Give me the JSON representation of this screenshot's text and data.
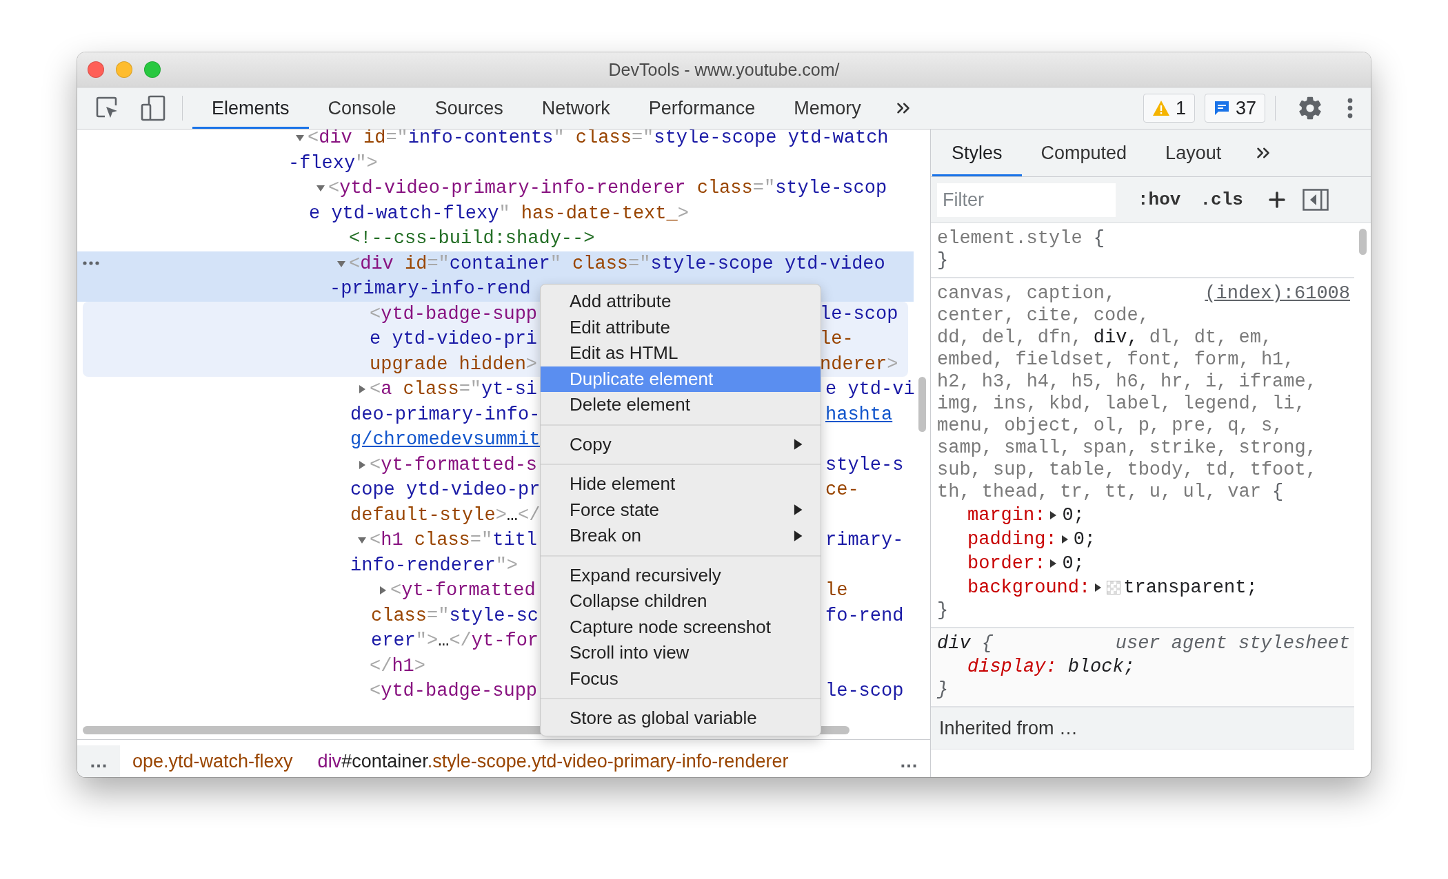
{
  "window": {
    "title": "DevTools - www.youtube.com/"
  },
  "toolbar": {
    "tabs": [
      {
        "label": "Elements",
        "selected": true
      },
      {
        "label": "Console",
        "selected": false
      },
      {
        "label": "Sources",
        "selected": false
      },
      {
        "label": "Network",
        "selected": false
      },
      {
        "label": "Performance",
        "selected": false
      },
      {
        "label": "Memory",
        "selected": false
      }
    ],
    "warnings": "1",
    "messages": "37"
  },
  "elements": {
    "tree": [
      {
        "kind": "element",
        "expanded": true,
        "selected": false,
        "hovered": false,
        "lines": [
          {
            "left": [
              {
                "kind": "bracket",
                "text": "<"
              },
              {
                "kind": "tag",
                "text": "div"
              },
              {
                "kind": "attr",
                "text": " id"
              },
              {
                "kind": "bracket",
                "text": "=\""
              },
              {
                "kind": "value",
                "text": "info-contents"
              },
              {
                "kind": "bracket",
                "text": "\""
              },
              {
                "kind": "attr",
                "text": " class"
              },
              {
                "kind": "bracket",
                "text": "=\""
              },
              {
                "kind": "value",
                "text": "style-scope ytd-watch"
              }
            ]
          },
          {
            "left": [
              {
                "kind": "value",
                "text": "-flexy"
              },
              {
                "kind": "bracket",
                "text": "\">"
              }
            ]
          }
        ],
        "children": [
          {
            "kind": "element",
            "expanded": true,
            "selected": false,
            "hovered": false,
            "lines": [
              {
                "left": [
                  {
                    "kind": "bracket",
                    "text": "<"
                  },
                  {
                    "kind": "tag",
                    "text": "ytd-video-primary-info-renderer"
                  },
                  {
                    "kind": "attr",
                    "text": " class"
                  },
                  {
                    "kind": "bracket",
                    "text": "=\""
                  },
                  {
                    "kind": "value",
                    "text": "style-scop"
                  }
                ]
              },
              {
                "left": [
                  {
                    "kind": "value",
                    "text": "e ytd-watch-flexy"
                  },
                  {
                    "kind": "bracket",
                    "text": "\""
                  },
                  {
                    "kind": "attr",
                    "text": " has-date-text_"
                  },
                  {
                    "kind": "bracket",
                    "text": ">"
                  }
                ]
              }
            ],
            "children": [
              {
                "kind": "leaf",
                "selected": false,
                "hovered": false,
                "lines": [
                  {
                    "left": [
                      {
                        "kind": "comment",
                        "text": "<!--css-build:shady-->"
                      }
                    ]
                  }
                ]
              },
              {
                "kind": "element",
                "expanded": true,
                "selected": true,
                "hovered": false,
                "lines": [
                  {
                    "left": [
                      {
                        "kind": "bracket",
                        "text": "<"
                      },
                      {
                        "kind": "tag",
                        "text": "div"
                      },
                      {
                        "kind": "attr",
                        "text": " id"
                      },
                      {
                        "kind": "bracket",
                        "text": "=\""
                      },
                      {
                        "kind": "value",
                        "text": "container"
                      },
                      {
                        "kind": "bracket",
                        "text": "\""
                      },
                      {
                        "kind": "attr",
                        "text": " class"
                      },
                      {
                        "kind": "bracket",
                        "text": "=\""
                      },
                      {
                        "kind": "value",
                        "text": "style-scope ytd-video"
                      }
                    ]
                  },
                  {
                    "left": [
                      {
                        "kind": "value",
                        "text": "-primary-info-rend"
                      }
                    ]
                  }
                ],
                "children": [
                  {
                    "kind": "leaf",
                    "selected": false,
                    "hovered": true,
                    "lines": [
                      {
                        "left": [
                          {
                            "kind": "bracket",
                            "text": "<"
                          },
                          {
                            "kind": "tag",
                            "text": "ytd-badge-supp"
                          }
                        ],
                        "right": [
                          {
                            "kind": "value",
                            "text": "le-scop"
                          }
                        ]
                      },
                      {
                        "left": [
                          {
                            "kind": "value",
                            "text": "e ytd-video-pri"
                          }
                        ],
                        "right": [
                          {
                            "kind": "attr",
                            "text": "le-"
                          }
                        ]
                      },
                      {
                        "left": [
                          {
                            "kind": "attr",
                            "text": "upgrade hidden"
                          },
                          {
                            "kind": "bracket",
                            "text": ">"
                          }
                        ],
                        "right": [
                          {
                            "kind": "attr",
                            "text": "nderer"
                          },
                          {
                            "kind": "bracket",
                            "text": ">"
                          }
                        ]
                      }
                    ]
                  },
                  {
                    "kind": "element",
                    "expanded": false,
                    "selected": false,
                    "hovered": false,
                    "lines": [
                      {
                        "left": [
                          {
                            "kind": "bracket",
                            "text": "<"
                          },
                          {
                            "kind": "tag",
                            "text": "a"
                          },
                          {
                            "kind": "attr",
                            "text": " class"
                          },
                          {
                            "kind": "bracket",
                            "text": "=\""
                          },
                          {
                            "kind": "value",
                            "text": "yt-si"
                          }
                        ],
                        "right": [
                          {
                            "kind": "value",
                            "text": "e ytd-vi"
                          }
                        ]
                      },
                      {
                        "left": [
                          {
                            "kind": "value",
                            "text": "deo-primary-info-"
                          }
                        ],
                        "right": [
                          {
                            "kind": "link",
                            "text": "hashta"
                          }
                        ]
                      },
                      {
                        "left": [
                          {
                            "kind": "link",
                            "text": "g/chromedevsummit"
                          }
                        ]
                      }
                    ]
                  },
                  {
                    "kind": "element",
                    "expanded": false,
                    "selected": false,
                    "hovered": false,
                    "lines": [
                      {
                        "left": [
                          {
                            "kind": "bracket",
                            "text": "<"
                          },
                          {
                            "kind": "tag",
                            "text": "yt-formatted-s"
                          }
                        ],
                        "right": [
                          {
                            "kind": "value",
                            "text": "style-s"
                          }
                        ]
                      },
                      {
                        "left": [
                          {
                            "kind": "value",
                            "text": "cope ytd-video-pr"
                          }
                        ],
                        "right": [
                          {
                            "kind": "attr",
                            "text": "ce-"
                          }
                        ]
                      },
                      {
                        "left": [
                          {
                            "kind": "attr",
                            "text": "default-style"
                          },
                          {
                            "kind": "bracket",
                            "text": ">"
                          },
                          {
                            "kind": "text",
                            "text": "…"
                          },
                          {
                            "kind": "bracket",
                            "text": "</"
                          }
                        ]
                      }
                    ]
                  },
                  {
                    "kind": "element",
                    "expanded": true,
                    "selected": false,
                    "hovered": false,
                    "lines": [
                      {
                        "left": [
                          {
                            "kind": "bracket",
                            "text": "<"
                          },
                          {
                            "kind": "tag",
                            "text": "h1"
                          },
                          {
                            "kind": "attr",
                            "text": " class"
                          },
                          {
                            "kind": "bracket",
                            "text": "=\""
                          },
                          {
                            "kind": "value",
                            "text": "titl"
                          }
                        ],
                        "right": [
                          {
                            "kind": "value",
                            "text": "rimary-"
                          }
                        ]
                      },
                      {
                        "left": [
                          {
                            "kind": "value",
                            "text": "info-renderer"
                          },
                          {
                            "kind": "bracket",
                            "text": "\">"
                          }
                        ]
                      }
                    ],
                    "children": [
                      {
                        "kind": "element",
                        "expanded": false,
                        "selected": false,
                        "hovered": false,
                        "lines": [
                          {
                            "left": [
                              {
                                "kind": "bracket",
                                "text": "<"
                              },
                              {
                                "kind": "tag",
                                "text": "yt-formatted"
                              }
                            ],
                            "right": [
                              {
                                "kind": "attr",
                                "text": "le"
                              }
                            ]
                          },
                          {
                            "left": [
                              {
                                "kind": "attr",
                                "text": "class"
                              },
                              {
                                "kind": "bracket",
                                "text": "=\""
                              },
                              {
                                "kind": "value",
                                "text": "style-sc"
                              }
                            ],
                            "right": [
                              {
                                "kind": "value",
                                "text": "fo-rend"
                              }
                            ]
                          },
                          {
                            "left": [
                              {
                                "kind": "value",
                                "text": "erer"
                              },
                              {
                                "kind": "bracket",
                                "text": "\">"
                              },
                              {
                                "kind": "text",
                                "text": "…"
                              },
                              {
                                "kind": "bracket",
                                "text": "</"
                              },
                              {
                                "kind": "tag",
                                "text": "yt-for"
                              }
                            ]
                          }
                        ]
                      }
                    ]
                  },
                  {
                    "kind": "leaf",
                    "selected": false,
                    "hovered": false,
                    "lines": [
                      {
                        "left": [
                          {
                            "kind": "bracket",
                            "text": "</"
                          },
                          {
                            "kind": "tag",
                            "text": "h1"
                          },
                          {
                            "kind": "bracket",
                            "text": ">"
                          }
                        ]
                      }
                    ]
                  },
                  {
                    "kind": "leaf",
                    "selected": false,
                    "hovered": false,
                    "lines": [
                      {
                        "left": [
                          {
                            "kind": "bracket",
                            "text": "<"
                          },
                          {
                            "kind": "tag",
                            "text": "ytd-badge-supp"
                          }
                        ],
                        "right": [
                          {
                            "kind": "value",
                            "text": "le-scop"
                          }
                        ]
                      }
                    ]
                  }
                ]
              }
            ]
          }
        ]
      }
    ]
  },
  "menu": {
    "groups": [
      [
        {
          "label": "Add attribute",
          "highlighted": false,
          "submenu": false
        },
        {
          "label": "Edit attribute",
          "highlighted": false,
          "submenu": false
        },
        {
          "label": "Edit as HTML",
          "highlighted": false,
          "submenu": false
        },
        {
          "label": "Duplicate element",
          "highlighted": true,
          "submenu": false
        },
        {
          "label": "Delete element",
          "highlighted": false,
          "submenu": false
        }
      ],
      [
        {
          "label": "Copy",
          "highlighted": false,
          "submenu": true
        }
      ],
      [
        {
          "label": "Hide element",
          "highlighted": false,
          "submenu": false
        },
        {
          "label": "Force state",
          "highlighted": false,
          "submenu": true
        },
        {
          "label": "Break on",
          "highlighted": false,
          "submenu": true
        }
      ],
      [
        {
          "label": "Expand recursively",
          "highlighted": false,
          "submenu": false
        },
        {
          "label": "Collapse children",
          "highlighted": false,
          "submenu": false
        },
        {
          "label": "Capture node screenshot",
          "highlighted": false,
          "submenu": false
        },
        {
          "label": "Scroll into view",
          "highlighted": false,
          "submenu": false
        },
        {
          "label": "Focus",
          "highlighted": false,
          "submenu": false
        }
      ],
      [
        {
          "label": "Store as global variable",
          "highlighted": false,
          "submenu": false
        }
      ]
    ]
  },
  "breadcrumbs": {
    "leading": "…",
    "crumbs": [
      {
        "parts": [
          {
            "kind": "attr",
            "text": "ope.ytd-watch-flexy"
          }
        ]
      },
      {
        "parts": [
          {
            "kind": "tag",
            "text": "div"
          },
          {
            "kind": "text",
            "text": "#container"
          },
          {
            "kind": "attr",
            "text": ".style-scope.ytd-video-primary-info-renderer"
          }
        ]
      }
    ],
    "trailing": "…"
  },
  "styles": {
    "tabs": [
      {
        "label": "Styles",
        "selected": true
      },
      {
        "label": "Computed",
        "selected": false
      },
      {
        "label": "Layout",
        "selected": false
      }
    ],
    "filter": {
      "placeholder": "Filter"
    },
    "hov": ":hov",
    "cls": ".cls",
    "rules": [
      {
        "kind": "rule",
        "user_agent": false,
        "selector_lines": [
          [
            {
              "text": "element.style",
              "matched": false
            }
          ]
        ],
        "open": "{",
        "close": "}"
      },
      {
        "kind": "rule",
        "user_agent": false,
        "source": "(index):61008",
        "selector_lines": [
          [
            {
              "text": "canvas,",
              "matched": false
            },
            {
              "text": "caption,",
              "matched": false
            }
          ],
          [
            {
              "text": "center,",
              "matched": false
            },
            {
              "text": "cite,",
              "matched": false
            },
            {
              "text": "code,",
              "matched": false
            }
          ],
          [
            {
              "text": "dd,",
              "matched": false
            },
            {
              "text": "del,",
              "matched": false
            },
            {
              "text": "dfn,",
              "matched": false
            },
            {
              "text": "div,",
              "matched": true
            },
            {
              "text": "dl,",
              "matched": false
            },
            {
              "text": "dt,",
              "matched": false
            },
            {
              "text": "em,",
              "matched": false
            }
          ],
          [
            {
              "text": "embed,",
              "matched": false
            },
            {
              "text": "fieldset,",
              "matched": false
            },
            {
              "text": "font,",
              "matched": false
            },
            {
              "text": "form,",
              "matched": false
            },
            {
              "text": "h1,",
              "matched": false
            }
          ],
          [
            {
              "text": "h2,",
              "matched": false
            },
            {
              "text": "h3,",
              "matched": false
            },
            {
              "text": "h4,",
              "matched": false
            },
            {
              "text": "h5,",
              "matched": false
            },
            {
              "text": "h6,",
              "matched": false
            },
            {
              "text": "hr,",
              "matched": false
            },
            {
              "text": "i,",
              "matched": false
            },
            {
              "text": "iframe,",
              "matched": false
            }
          ],
          [
            {
              "text": "img,",
              "matched": false
            },
            {
              "text": "ins,",
              "matched": false
            },
            {
              "text": "kbd,",
              "matched": false
            },
            {
              "text": "label,",
              "matched": false
            },
            {
              "text": "legend,",
              "matched": false
            },
            {
              "text": "li,",
              "matched": false
            }
          ],
          [
            {
              "text": "menu,",
              "matched": false
            },
            {
              "text": "object,",
              "matched": false
            },
            {
              "text": "ol,",
              "matched": false
            },
            {
              "text": "p,",
              "matched": false
            },
            {
              "text": "pre,",
              "matched": false
            },
            {
              "text": "q,",
              "matched": false
            },
            {
              "text": "s,",
              "matched": false
            }
          ],
          [
            {
              "text": "samp,",
              "matched": false
            },
            {
              "text": "small,",
              "matched": false
            },
            {
              "text": "span,",
              "matched": false
            },
            {
              "text": "strike,",
              "matched": false
            },
            {
              "text": "strong,",
              "matched": false
            }
          ],
          [
            {
              "text": "sub,",
              "matched": false
            },
            {
              "text": "sup,",
              "matched": false
            },
            {
              "text": "table,",
              "matched": false
            },
            {
              "text": "tbody,",
              "matched": false
            },
            {
              "text": "td,",
              "matched": false
            },
            {
              "text": "tfoot,",
              "matched": false
            }
          ],
          [
            {
              "text": "th,",
              "matched": false
            },
            {
              "text": "thead,",
              "matched": false
            },
            {
              "text": "tr,",
              "matched": false
            },
            {
              "text": "tt,",
              "matched": false
            },
            {
              "text": "u,",
              "matched": false
            },
            {
              "text": "ul,",
              "matched": false
            },
            {
              "text": "var",
              "matched": false
            }
          ]
        ],
        "open": "{",
        "properties": [
          {
            "name": "margin:",
            "value": "0;",
            "expandable": true,
            "swatch": false
          },
          {
            "name": "padding:",
            "value": "0;",
            "expandable": true,
            "swatch": false
          },
          {
            "name": "border:",
            "value": "0;",
            "expandable": true,
            "swatch": false
          },
          {
            "name": "background:",
            "value": "transparent;",
            "expandable": true,
            "swatch": true
          }
        ],
        "close": "}"
      },
      {
        "kind": "rule",
        "user_agent": true,
        "source": "user agent stylesheet",
        "selector_lines": [
          [
            {
              "text": "div",
              "matched": true
            }
          ]
        ],
        "open": "{",
        "properties": [
          {
            "name": "display:",
            "value": "block;",
            "expandable": false,
            "swatch": false
          }
        ],
        "close": "}"
      },
      {
        "kind": "inherited",
        "label": "Inherited from …"
      }
    ]
  }
}
